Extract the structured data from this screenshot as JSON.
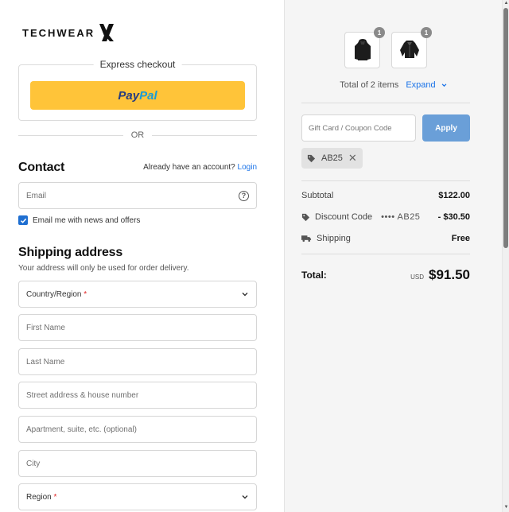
{
  "brand": {
    "name": "TECHWEAR"
  },
  "express": {
    "title": "Express checkout",
    "paypal_part1": "Pay",
    "paypal_part2": "Pal",
    "or_label": "OR"
  },
  "contact": {
    "title": "Contact",
    "account_prompt": "Already have an account?",
    "login_label": "Login",
    "email_placeholder": "Email",
    "newsletter_label": "Email me with news and offers",
    "newsletter_checked": true
  },
  "shipping": {
    "title": "Shipping address",
    "subtitle": "Your address will only be used for order delivery.",
    "country_label": "Country/Region",
    "first_name": "First Name",
    "last_name": "Last Name",
    "street": "Street address & house number",
    "apartment": "Apartment, suite, etc. (optional)",
    "city": "City",
    "region_label": "Region",
    "required_mark": "*"
  },
  "summary": {
    "items": [
      {
        "name": "black hoodie",
        "quantity": "1"
      },
      {
        "name": "black jacket",
        "quantity": "1"
      }
    ],
    "items_total_text": "Total of 2 items",
    "expand_label": "Expand",
    "coupon_placeholder": "Gift Card / Coupon Code",
    "apply_label": "Apply",
    "applied_code": "AB25",
    "subtotal_label": "Subtotal",
    "subtotal_value": "$122.00",
    "discount_label": "Discount Code",
    "discount_mask": "••••",
    "discount_code": "AB25",
    "discount_value": "- $30.50",
    "shipping_label": "Shipping",
    "shipping_value": "Free",
    "total_label": "Total:",
    "currency": "USD",
    "total_value": "$91.50"
  },
  "colors": {
    "accent": "#1a73e8",
    "paypal_yellow": "#ffc439",
    "apply_button": "#6a9fd8",
    "sidebar_bg": "#f5f5f5"
  }
}
